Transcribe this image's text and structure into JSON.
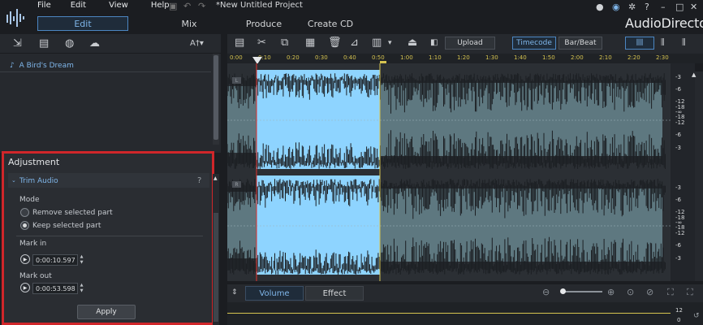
{
  "app": {
    "title": "*New Untitled Project",
    "brand": "AudioDirector"
  },
  "menu": [
    "File",
    "Edit",
    "View",
    "Help"
  ],
  "tabs": [
    {
      "label": "Edit",
      "active": true
    },
    {
      "label": "Mix",
      "active": false
    },
    {
      "label": "Produce",
      "active": false
    },
    {
      "label": "Create CD",
      "active": false
    }
  ],
  "library": {
    "font_menu_label": "A†▾",
    "tracks": [
      "A Bird's Dream"
    ]
  },
  "adjustment": {
    "title": "Adjustment",
    "section": "Trim Audio",
    "help": "?",
    "mode_label": "Mode",
    "modes": [
      {
        "label": "Remove selected part",
        "selected": false
      },
      {
        "label": "Keep selected part",
        "selected": true
      }
    ],
    "mark_in_label": "Mark in",
    "mark_in": "0:00:10.597",
    "mark_out_label": "Mark out",
    "mark_out": "0:00:53.598",
    "apply_label": "Apply"
  },
  "toolbar": {
    "upload_label": "Upload",
    "timecode_label": "Timecode",
    "barbeat_label": "Bar/Beat"
  },
  "ruler": [
    "0:00",
    "0:10",
    "0:20",
    "0:30",
    "0:40",
    "0:50",
    "1:00",
    "1:10",
    "1:20",
    "1:30",
    "1:40",
    "1:50",
    "2:00",
    "2:10",
    "2:20",
    "2:30"
  ],
  "channels": [
    "L",
    "R"
  ],
  "db_scale": [
    "-3",
    "-6",
    "-12",
    "-18",
    "-∞",
    "-18",
    "-12",
    "-6",
    "-3"
  ],
  "db_scale_right": [
    "-3",
    "-6",
    "-12",
    "-18",
    "-∞",
    "-18",
    "-12",
    "-6",
    "-3"
  ],
  "bottom_tabs": [
    {
      "label": "Volume",
      "active": true
    },
    {
      "label": "Effect",
      "active": false
    }
  ],
  "bottom_scale": [
    "12",
    "0"
  ],
  "colors": {
    "accent": "#7fb6ea",
    "highlight": "#d0262a",
    "selection": "#8ed4ff",
    "waveform": "#1c1f23",
    "wave_bg": "#5e7880",
    "ruler_text": "#d6c350"
  }
}
